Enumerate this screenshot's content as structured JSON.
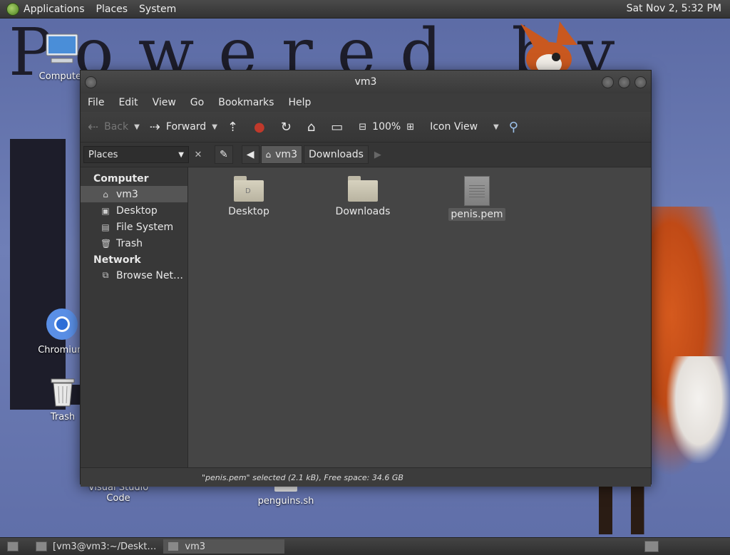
{
  "top_panel": {
    "menus": [
      "Applications",
      "Places",
      "System"
    ],
    "clock": "Sat Nov 2,  5:32 PM"
  },
  "wallpaper": {
    "text": "Powered by"
  },
  "desktop_icons": {
    "computer": "Computer",
    "chromium": "Chromium",
    "trash": "Trash",
    "vscode": "Visual Studio Code",
    "penguins": "penguins.sh"
  },
  "window": {
    "title": "vm3",
    "menus": [
      "File",
      "Edit",
      "View",
      "Go",
      "Bookmarks",
      "Help"
    ],
    "toolbar": {
      "back": "Back",
      "forward": "Forward",
      "zoom": "100%",
      "view_mode": "Icon View"
    },
    "location": {
      "places_label": "Places",
      "crumbs": [
        "vm3",
        "Downloads"
      ]
    },
    "sidebar": {
      "computer_header": "Computer",
      "computer_items": [
        "vm3",
        "Desktop",
        "File System",
        "Trash"
      ],
      "network_header": "Network",
      "network_items": [
        "Browse Net…"
      ]
    },
    "files": [
      {
        "name": "Desktop",
        "type": "folder"
      },
      {
        "name": "Downloads",
        "type": "folder"
      },
      {
        "name": "penis.pem",
        "type": "file"
      }
    ],
    "status": "\"penis.pem\" selected (2.1 kB), Free space: 34.6 GB"
  },
  "bottom_panel": {
    "tasks": [
      "[vm3@vm3:~/Deskt…",
      "vm3"
    ]
  },
  "colors": {
    "wallpaper": "#6f7fb7",
    "window_bg": "#3c3c3c",
    "content_bg": "#454545",
    "fox_orange": "#c04a16"
  }
}
